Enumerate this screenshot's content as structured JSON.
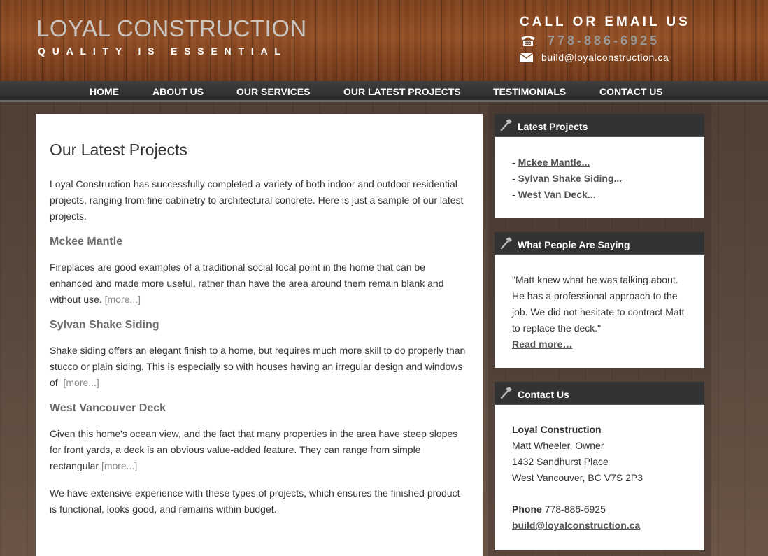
{
  "header": {
    "logo_title": "LOYAL CONSTRUCTION",
    "tagline": "QUALITY IS ESSENTIAL",
    "contact_title": "CALL OR EMAIL US",
    "phone": "778-886-6925",
    "email": "build@loyalconstruction.ca",
    "icons": [
      "phone-icon",
      "mail-icon"
    ]
  },
  "nav": {
    "items": [
      "HOME",
      "ABOUT US",
      "OUR SERVICES",
      "OUR LATEST PROJECTS",
      "TESTIMONIALS",
      "CONTACT US"
    ]
  },
  "main": {
    "title": "Our Latest Projects",
    "intro": "Loyal Construction has successfully completed a variety of both indoor and outdoor residential projects, ranging from fine cabinetry to architectural concrete. Here is just a sample of our latest projects.",
    "projects": [
      {
        "title": "Mckee Mantle",
        "text": "Fireplaces are good examples of a traditional social focal point in the home that can be enhanced and made more useful, rather than have the area around them remain blank and without use.",
        "more": "[more...]"
      },
      {
        "title": "Sylvan Shake Siding",
        "text": "Shake siding offers an elegant finish to a home, but requires much more skill to do properly than stucco or plain siding. This is especially so with houses having an irregular design and windows of",
        "more": "[more...]"
      },
      {
        "title": "West Vancouver Deck",
        "text": "Given this home's ocean view, and the fact that many properties in the area have steep slopes for front yards, a deck is an obvious value-added feature. They can range from simple rectangular",
        "more": "[more...]"
      }
    ],
    "closing": "We have extensive experience with these types of projects, which ensures the finished product is functional, looks good, and remains within budget."
  },
  "sidebar": {
    "latest": {
      "title": "Latest Projects",
      "links": [
        "Mckee Mantle...",
        "Sylvan Shake Siding...",
        "West Van Deck..."
      ],
      "bullet": "- "
    },
    "testimonial": {
      "title": "What People Are Saying",
      "quote": "\"Matt knew what he was talking about. He has a professional approach to the job. We did not hesitate to contract Matt to replace the deck.\"",
      "link": "Read more…"
    },
    "contact": {
      "title": "Contact Us",
      "company": "Loyal Construction",
      "owner": "Matt Wheeler, Owner",
      "street": "1432 Sandhurst Place",
      "city": "West Vancouver, BC V7S 2P3",
      "phone_label": "Phone",
      "phone": " 778-886-6925",
      "email": "build@loyalconstruction.ca"
    },
    "widget_icon": "hammer-icon"
  }
}
